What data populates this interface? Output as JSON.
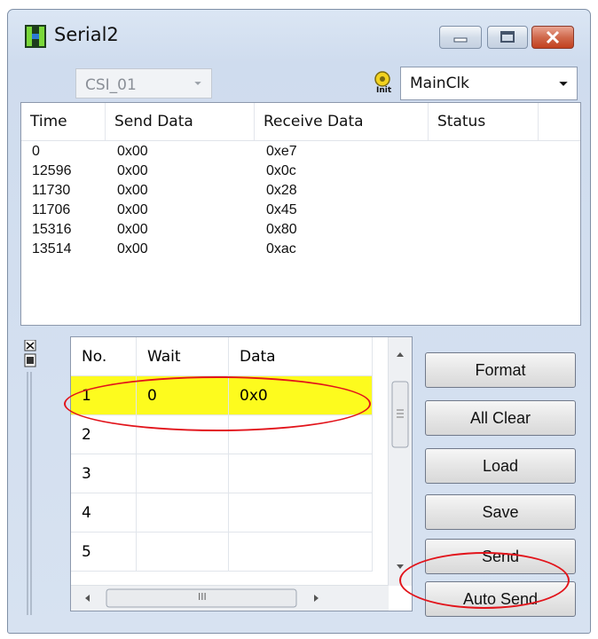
{
  "window": {
    "title": "Serial2",
    "title_icon": "hardware-chip-icon"
  },
  "toolbar": {
    "channel": {
      "value": "CSI_01"
    },
    "clock_icon": "key-init-icon",
    "clock_icon_label": "Init",
    "clock": {
      "value": "MainClk"
    }
  },
  "log": {
    "columns": [
      "Time",
      "Send Data",
      "Receive Data",
      "Status"
    ],
    "rows": [
      {
        "time": "0",
        "send": "0x00",
        "receive": "0xe7",
        "status": ""
      },
      {
        "time": "12596",
        "send": "0x00",
        "receive": "0x0c",
        "status": ""
      },
      {
        "time": "11730",
        "send": "0x00",
        "receive": "0x28",
        "status": ""
      },
      {
        "time": "11706",
        "send": "0x00",
        "receive": "0x45",
        "status": ""
      },
      {
        "time": "15316",
        "send": "0x00",
        "receive": "0x80",
        "status": ""
      },
      {
        "time": "13514",
        "send": "0x00",
        "receive": "0xac",
        "status": ""
      }
    ]
  },
  "grid": {
    "columns": [
      "No.",
      "Wait",
      "Data"
    ],
    "rows": [
      {
        "no": "1",
        "wait": "0",
        "data": "0x0",
        "selected": true
      },
      {
        "no": "2",
        "wait": "",
        "data": ""
      },
      {
        "no": "3",
        "wait": "",
        "data": ""
      },
      {
        "no": "4",
        "wait": "",
        "data": ""
      },
      {
        "no": "5",
        "wait": "",
        "data": ""
      }
    ],
    "selected_color": "#fdfb1e",
    "hscroll_grip": "III"
  },
  "buttons": {
    "format": "Format",
    "all_clear": "All Clear",
    "load": "Load",
    "save": "Save",
    "send": "Send",
    "auto_send": "Auto Send"
  },
  "highlight_color": "#e2141b"
}
